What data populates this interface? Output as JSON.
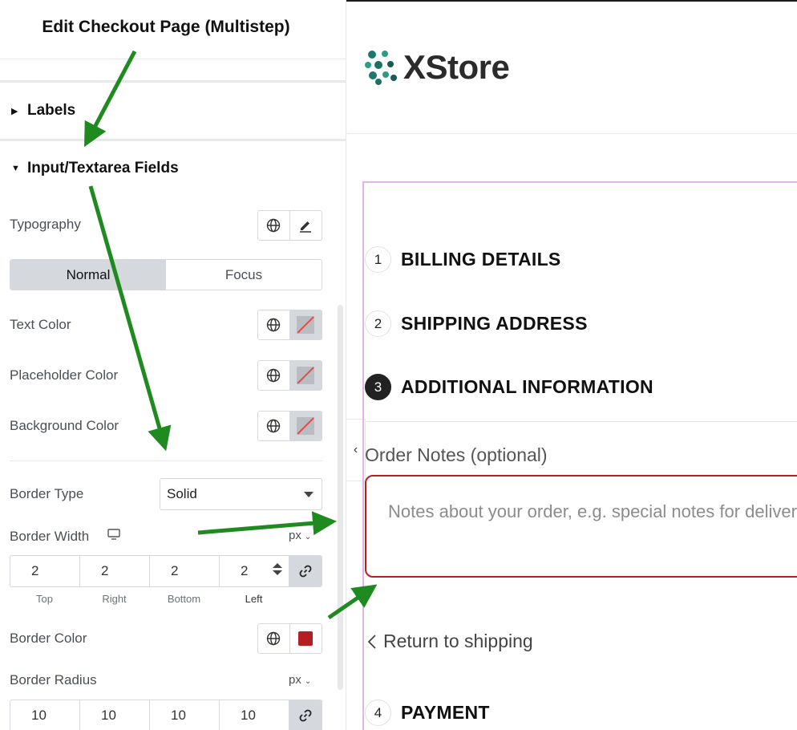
{
  "panel": {
    "title": "Edit Checkout Page (Multistep)",
    "sections": {
      "labels": "Labels",
      "fields": "Input/Textarea Fields"
    },
    "typography_label": "Typography",
    "tabs": {
      "normal": "Normal",
      "focus": "Focus"
    },
    "text_color_label": "Text Color",
    "placeholder_color_label": "Placeholder Color",
    "background_color_label": "Background Color",
    "border_type_label": "Border Type",
    "border_type_value": "Solid",
    "border_width_label": "Border Width",
    "border_width_unit": "px",
    "border_width": {
      "top": "2",
      "right": "2",
      "bottom": "2",
      "left": "2"
    },
    "dim_labels": {
      "top": "Top",
      "right": "Right",
      "bottom": "Bottom",
      "left": "Left"
    },
    "border_color_label": "Border Color",
    "border_color_value": "#b51f24",
    "border_radius_label": "Border Radius",
    "border_radius_unit": "px",
    "border_radius": {
      "top": "10",
      "right": "10",
      "bottom": "10",
      "left": "10"
    }
  },
  "preview": {
    "logo_text": "XStore",
    "steps": [
      {
        "num": "1",
        "title": "BILLING DETAILS"
      },
      {
        "num": "2",
        "title": "SHIPPING ADDRESS"
      },
      {
        "num": "3",
        "title": "ADDITIONAL INFORMATION"
      },
      {
        "num": "4",
        "title": "PAYMENT"
      }
    ],
    "order_notes_label": "Order Notes (optional)",
    "order_notes_placeholder": "Notes about your order, e.g. special notes for delivery.",
    "back_link": "Return to shipping"
  },
  "colors": {
    "annotation_arrow": "#1f8a1f",
    "accent_border": "#b51f24",
    "frame_highlight": "#e3b3ea"
  }
}
